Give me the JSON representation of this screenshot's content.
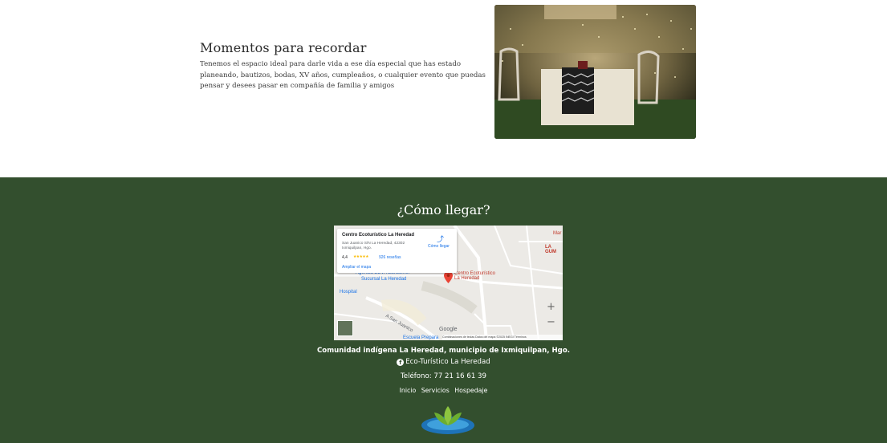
{
  "moment": {
    "title": "Momentos para recordar",
    "text": "Tenemos el espacio ideal para darle vida a ese día especial que has estado planeando, bautizos, bodas, XV años, cumpleaños, o cualquier evento que puedas pensar y desees pasar en compañía de familia y amigos"
  },
  "footer": {
    "title": "¿Cómo llegar?",
    "community": "Comunidad indígena La Heredad, municipio de Ixmiquilpan, Hgo.",
    "facebook_label": "Eco-Turístico La Heredad",
    "phone": "Teléfono: 77 21 16 61 39",
    "nav": [
      "Inicio",
      "Servicios",
      "Hospedaje"
    ]
  },
  "map": {
    "place_name": "Centro Ecoturístico La Heredad",
    "address": "San Juanico S/N La Heredad, 42302 Ixmiquilpan, Hgo.",
    "rating": "4,4",
    "stars": "★★★★★",
    "reviews": "926 reseñas",
    "enlarge": "Ampliar el mapa",
    "directions": "Cómo llegar",
    "pin_label_1": "Centro Ecoturístico",
    "pin_label_2": "La Heredad",
    "bank_label_1": "Agencia BBVA Bancomer",
    "bank_label_2": "Sucursal La Heredad",
    "street_label": "A San Juanico",
    "hospital_label": "Hospital",
    "la_gum_label": "LA GUM",
    "school_label": "Escuela Prepara",
    "mar_label": "Mar",
    "google": "Google",
    "attribution": "Combinaciones de teclas   Datos del mapa ©2025 INEGI   Términos",
    "zoom_in": "+",
    "zoom_out": "−"
  },
  "colors": {
    "footer_bg": "#334f2e",
    "pin": "#ea4335",
    "link": "#1a73e8"
  }
}
